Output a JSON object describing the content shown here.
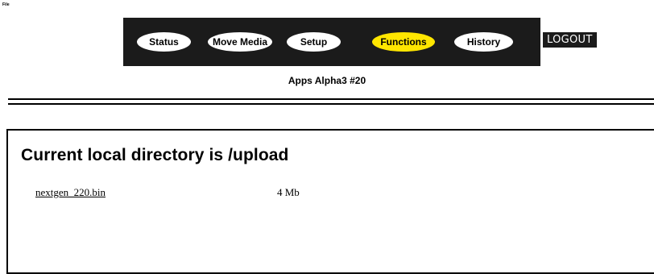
{
  "menu": {
    "file_label": "File"
  },
  "nav": {
    "buttons": [
      {
        "label": "Status",
        "active": false
      },
      {
        "label": "Move Media",
        "active": false
      },
      {
        "label": "Setup",
        "active": false
      },
      {
        "label": "Functions",
        "active": true
      },
      {
        "label": "History",
        "active": false
      }
    ],
    "logout_label": "LOGOUT",
    "active_color": "#ffe600"
  },
  "device": {
    "name": "Apps Alpha3 #20"
  },
  "directory": {
    "heading": "Current local directory is /upload",
    "files": [
      {
        "name": "nextgen_220.bin",
        "size": "4  Mb"
      }
    ]
  }
}
